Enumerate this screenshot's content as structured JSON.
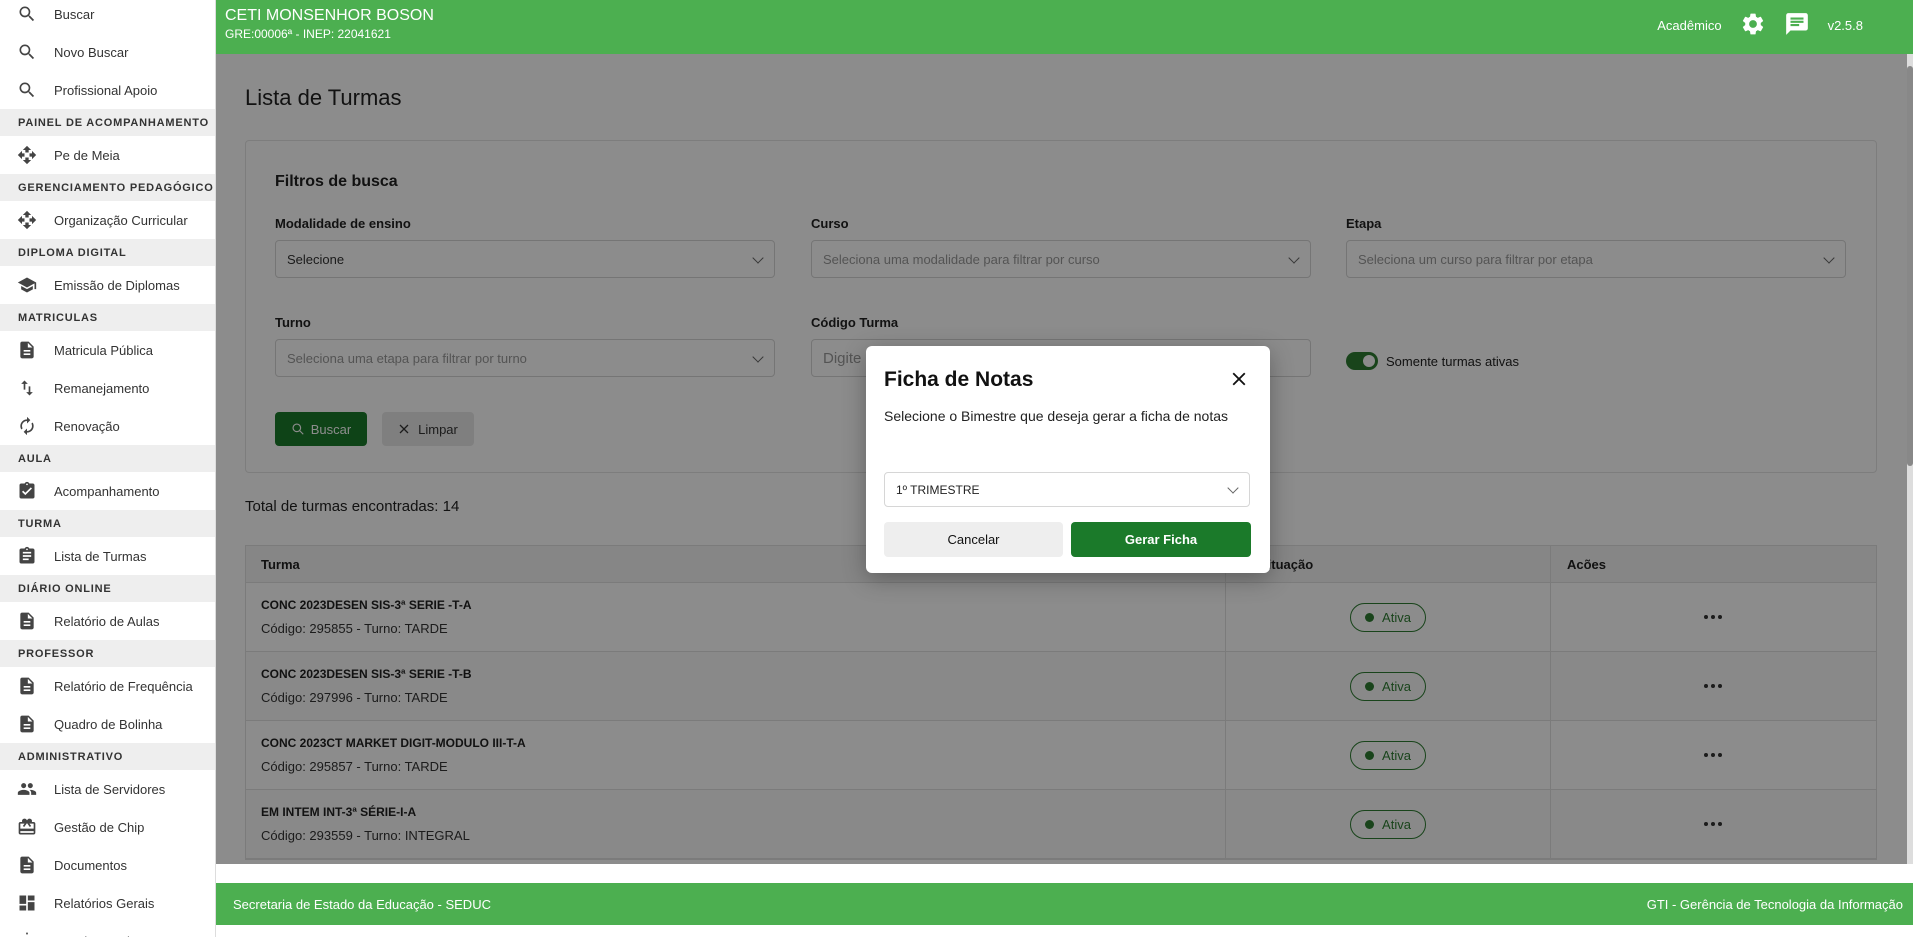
{
  "sidebar": {
    "items": [
      {
        "type": "item",
        "label": "Buscar",
        "icon": "search-icon"
      },
      {
        "type": "item",
        "label": "Novo Buscar",
        "icon": "search-icon"
      },
      {
        "type": "item",
        "label": "Profissional Apoio",
        "icon": "search-icon"
      },
      {
        "type": "section",
        "label": "PAINEL DE ACOMPANHAMENTO"
      },
      {
        "type": "item",
        "label": "Pe de Meia",
        "icon": "move-icon"
      },
      {
        "type": "section",
        "label": "GERENCIAMENTO PEDAGÓGICO"
      },
      {
        "type": "item",
        "label": "Organização Curricular",
        "icon": "move-icon"
      },
      {
        "type": "section",
        "label": "DIPLOMA DIGITAL"
      },
      {
        "type": "item",
        "label": "Emissão de Diplomas",
        "icon": "graduation-cap-icon"
      },
      {
        "type": "section",
        "label": "MATRICULAS"
      },
      {
        "type": "item",
        "label": "Matricula Pública",
        "icon": "document-icon"
      },
      {
        "type": "item",
        "label": "Remanejamento",
        "icon": "swap-vertical-icon"
      },
      {
        "type": "item",
        "label": "Renovação",
        "icon": "refresh-icon"
      },
      {
        "type": "section",
        "label": "AULA"
      },
      {
        "type": "item",
        "label": "Acompanhamento",
        "icon": "checkbox-icon"
      },
      {
        "type": "section",
        "label": "TURMA"
      },
      {
        "type": "item",
        "label": "Lista de Turmas",
        "icon": "clipboard-icon"
      },
      {
        "type": "section",
        "label": "DIÁRIO ONLINE"
      },
      {
        "type": "item",
        "label": "Relatório de Aulas",
        "icon": "document-icon"
      },
      {
        "type": "section",
        "label": "PROFESSOR"
      },
      {
        "type": "item",
        "label": "Relatório de Frequência",
        "icon": "document-icon"
      },
      {
        "type": "item",
        "label": "Quadro de Bolinha",
        "icon": "document-icon"
      },
      {
        "type": "section",
        "label": "ADMINISTRATIVO"
      },
      {
        "type": "item",
        "label": "Lista de Servidores",
        "icon": "people-icon"
      },
      {
        "type": "item",
        "label": "Gestão de Chip",
        "icon": "sim-card-icon"
      },
      {
        "type": "item",
        "label": "Documentos",
        "icon": "document-icon"
      },
      {
        "type": "item",
        "label": "Relatórios Gerais",
        "icon": "dashboard-icon"
      },
      {
        "type": "item",
        "label": "Estudo Escolar",
        "icon": "settings-icon"
      }
    ]
  },
  "header": {
    "school_name": "CETI MONSENHOR BOSON",
    "school_sub": "GRE:00006ª - INEP: 22041621",
    "module": "Acadêmico",
    "version": "v2.5.8"
  },
  "main": {
    "title": "Lista de Turmas",
    "filters": {
      "title": "Filtros de busca",
      "modalidade_label": "Modalidade de ensino",
      "modalidade_value": "Selecione",
      "curso_label": "Curso",
      "curso_placeholder": "Seleciona uma modalidade para filtrar por curso",
      "etapa_label": "Etapa",
      "etapa_placeholder": "Seleciona um curso para filtrar por etapa",
      "turno_label": "Turno",
      "turno_placeholder": "Seleciona uma etapa para filtrar por turno",
      "codigo_label": "Código Turma",
      "codigo_placeholder": "Digite",
      "ativas_label": "Somente turmas ativas",
      "buscar_label": "Buscar",
      "limpar_label": "Limpar"
    },
    "total": "Total de turmas encontradas: 14",
    "table": {
      "headers": [
        "Turma",
        "Situação",
        "Acões"
      ],
      "rows": [
        {
          "name": "CONC 2023DESEN SIS-3ª SERIE -T-A",
          "code": "Código: 295855 - Turno: TARDE",
          "status": "Ativa"
        },
        {
          "name": "CONC 2023DESEN SIS-3ª SERIE -T-B",
          "code": "Código: 297996 - Turno: TARDE",
          "status": "Ativa"
        },
        {
          "name": "CONC 2023CT MARKET DIGIT-MODULO III-T-A",
          "code": "Código: 295857 - Turno: TARDE",
          "status": "Ativa"
        },
        {
          "name": "EM INTEM INT-3ª SÉRIE-I-A",
          "code": "Código: 293559 - Turno: INTEGRAL",
          "status": "Ativa"
        }
      ]
    }
  },
  "footer": {
    "left": "Secretaria de Estado da Educação - SEDUC",
    "right": "GTI - Gerência de Tecnologia da Informação"
  },
  "modal": {
    "title": "Ficha de Notas",
    "description": "Selecione o Bimestre que deseja gerar a ficha de notas",
    "select_value": "1º TRIMESTRE",
    "cancel_label": "Cancelar",
    "confirm_label": "Gerar Ficha"
  },
  "colors": {
    "header_green": "#4caf50",
    "button_green": "#1b7a2a",
    "status_green": "#2e7d32"
  }
}
